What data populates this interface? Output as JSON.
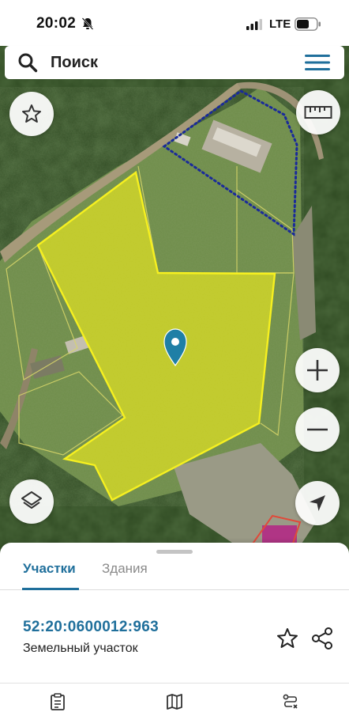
{
  "status_bar": {
    "time": "20:02",
    "network": "LTE",
    "icons": [
      "bell-slash-icon",
      "signal-icon",
      "battery-icon"
    ]
  },
  "search": {
    "placeholder": "Поиск",
    "icons": [
      "search-icon",
      "menu-icon"
    ]
  },
  "map": {
    "layer": "satellite",
    "selected_plot_color": "#f2ef1c",
    "neighbor_outline_color": "#1a2a9a",
    "marker_color": "#1f7fa6",
    "controls": [
      "star-outline-icon",
      "ruler-icon",
      "zoom-in-icon",
      "zoom-out-icon",
      "layers-icon",
      "locate-arrow-icon"
    ]
  },
  "sheet": {
    "tabs": [
      {
        "label": "Участки",
        "active": true
      },
      {
        "label": "Здания",
        "active": false
      }
    ],
    "parcel": {
      "cadastral_number": "52:20:0600012:963",
      "type": "Земельный участок"
    },
    "actions": [
      "star-outline-icon",
      "share-icon"
    ],
    "bottom_nav": [
      "document-list-icon",
      "map-book-icon",
      "route-icon"
    ],
    "accent_color": "#1f6f9b"
  }
}
